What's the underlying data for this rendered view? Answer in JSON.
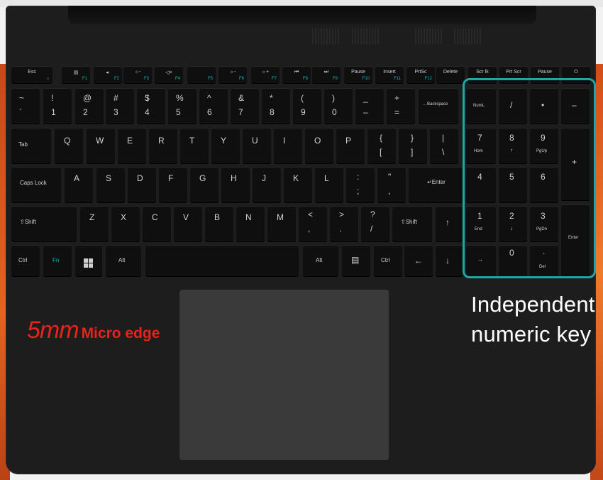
{
  "fn_row": [
    {
      "main": "Esc",
      "sub": "☼"
    },
    {
      "main": "▤",
      "sub": "F1"
    },
    {
      "main": "◂·",
      "sub": "F2"
    },
    {
      "main": "☼-",
      "sub": "F3"
    },
    {
      "main": "◁×",
      "sub": "F4"
    },
    {
      "main": "",
      "sub": "F5"
    },
    {
      "main": "☼-",
      "sub": "F6"
    },
    {
      "main": "☼+",
      "sub": "F7"
    },
    {
      "main": "⏮",
      "sub": "F8"
    },
    {
      "main": "⏭",
      "sub": "F9"
    },
    {
      "main": "Pause",
      "sub": "F10"
    },
    {
      "main": "Insert",
      "sub": "F11"
    },
    {
      "main": "PrtSc",
      "sub": "F12"
    },
    {
      "main": "Delete",
      "sub": ""
    },
    {
      "main": "Scr lk",
      "sub": ""
    },
    {
      "main": "Prt Scr",
      "sub": ""
    },
    {
      "main": "Pause",
      "sub": ""
    },
    {
      "main": "⏻",
      "sub": ""
    }
  ],
  "number_row": [
    {
      "top": "~",
      "bot": "`"
    },
    {
      "top": "!",
      "bot": "1"
    },
    {
      "top": "@",
      "bot": "2"
    },
    {
      "top": "#",
      "bot": "3"
    },
    {
      "top": "$",
      "bot": "4"
    },
    {
      "top": "%",
      "bot": "5"
    },
    {
      "top": "^",
      "bot": "6"
    },
    {
      "top": "&",
      "bot": "7"
    },
    {
      "top": "*",
      "bot": "8"
    },
    {
      "top": "(",
      "bot": "9"
    },
    {
      "top": ")",
      "bot": "0"
    },
    {
      "top": "_",
      "bot": "–"
    },
    {
      "top": "+",
      "bot": "="
    },
    {
      "top": "",
      "bot": "←Backspace"
    }
  ],
  "qwerty_row": [
    "Tab",
    "Q",
    "W",
    "E",
    "R",
    "T",
    "Y",
    "U",
    "I",
    "O",
    "P"
  ],
  "qwerty_symbols": [
    {
      "top": "{",
      "bot": "["
    },
    {
      "top": "}",
      "bot": "]"
    },
    {
      "top": "|",
      "bot": "\\"
    }
  ],
  "home_row": [
    "Caps Lock",
    "A",
    "S",
    "D",
    "F",
    "G",
    "H",
    "J",
    "K",
    "L"
  ],
  "home_symbols": [
    {
      "top": ":",
      "bot": ";"
    },
    {
      "top": "\"",
      "bot": ","
    }
  ],
  "enter_label": "↵Enter",
  "shift_row": [
    "⇧Shift",
    "Z",
    "X",
    "C",
    "V",
    "B",
    "N",
    "M"
  ],
  "shift_symbols": [
    {
      "top": "<",
      "bot": ","
    },
    {
      "top": ">",
      "bot": "."
    },
    {
      "top": "?",
      "bot": "/"
    }
  ],
  "rshift_label": "⇧Shift",
  "up_label": "↑",
  "bottom_row": {
    "ctrl": "Ctrl",
    "fn": "Fn",
    "alt": "Alt",
    "ralt": "Alt",
    "menu": "▤",
    "rctrl": "Ctrl",
    "left": "←",
    "down": "↓",
    "right": "→"
  },
  "numpad": {
    "numlock": "NumL",
    "slash": "/",
    "star": "•",
    "minus": "–",
    "k7": "7",
    "k7s": "Hom",
    "k8": "8",
    "k8s": "↑",
    "k9": "9",
    "k9s": "PgUp",
    "plus": "+",
    "k4": "4",
    "k5": "5",
    "k6": "6",
    "k1": "1",
    "k1s": "End",
    "k2": "2",
    "k2s": "↓",
    "k3": "3",
    "k3s": "PgDn",
    "enter": "Enter",
    "k0": "0",
    "dot": ".",
    "dels": "Del"
  },
  "caption": {
    "line1": "Independent",
    "line2": "numeric key"
  },
  "micro_edge": {
    "big": "5mm",
    "small": "Micro edge"
  },
  "colors": {
    "accent": "#1fa6a8",
    "red": "#e8231a",
    "orange": "#e3631f"
  }
}
